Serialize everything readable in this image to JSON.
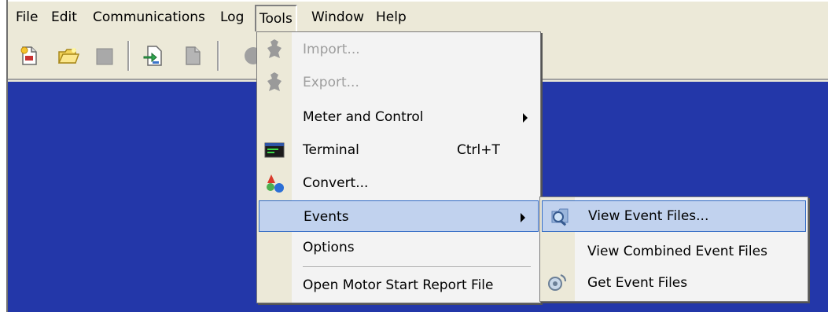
{
  "menubar": {
    "items": [
      {
        "label": "File"
      },
      {
        "label": "Edit"
      },
      {
        "label": "Communications"
      },
      {
        "label": "Log"
      },
      {
        "label": "Tools"
      },
      {
        "label": "Window"
      },
      {
        "label": "Help"
      }
    ]
  },
  "toolbar": {
    "icons": [
      "new-file-icon",
      "open-folder-icon",
      "stop-icon",
      "import-doc-icon",
      "document-icon",
      "disc-icon"
    ]
  },
  "tools_menu": {
    "items": [
      {
        "label": "Import...",
        "icon": "import-icon",
        "enabled": false
      },
      {
        "label": "Export...",
        "icon": "export-icon",
        "enabled": false
      },
      {
        "label": "Meter and Control",
        "submenu": true
      },
      {
        "label": "Terminal",
        "accel": "Ctrl+T",
        "icon": "terminal-icon"
      },
      {
        "label": "Convert...",
        "icon": "convert-icon"
      },
      {
        "label": "Events",
        "submenu": true,
        "highlighted": true
      },
      {
        "label": "Options"
      },
      {
        "label": "Open Motor Start Report File"
      }
    ]
  },
  "events_submenu": {
    "items": [
      {
        "label": "View Event Files...",
        "icon": "view-events-icon",
        "highlighted": true
      },
      {
        "label": "View Combined Event Files"
      },
      {
        "label": "Get Event Files",
        "icon": "get-events-icon"
      }
    ]
  },
  "colors": {
    "workspace": "#2337a9",
    "menu_highlight": "#c1d2ee",
    "highlight_border": "#316ac5",
    "chrome": "#ece9d8"
  }
}
